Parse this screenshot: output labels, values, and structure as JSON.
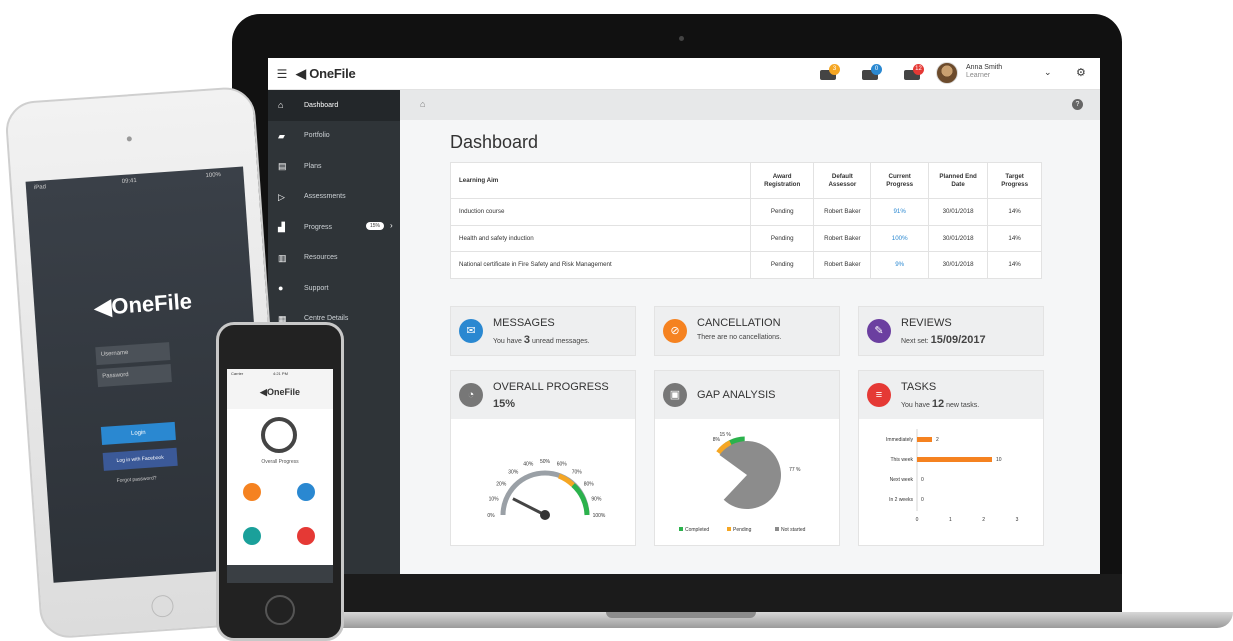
{
  "brand": "OneFile",
  "user": {
    "name": "Anna Smith",
    "role": "Learner"
  },
  "notifications": [
    {
      "icon": "megaphone-icon",
      "count": "3",
      "color": "#f5a623"
    },
    {
      "icon": "message-icon",
      "count": "0",
      "color": "#2a88d1"
    },
    {
      "icon": "tasks-icon",
      "count": "12",
      "color": "#e53935"
    }
  ],
  "sidebar": {
    "items": [
      {
        "label": "Dashboard",
        "icon": "home-icon"
      },
      {
        "label": "Portfolio",
        "icon": "folder-icon"
      },
      {
        "label": "Plans",
        "icon": "plans-icon"
      },
      {
        "label": "Assessments",
        "icon": "assessment-icon"
      },
      {
        "label": "Progress",
        "icon": "chart-icon",
        "badge": "15%"
      },
      {
        "label": "Resources",
        "icon": "resources-icon"
      },
      {
        "label": "Support",
        "icon": "support-icon"
      },
      {
        "label": "Centre Details",
        "icon": "building-icon"
      }
    ]
  },
  "page": {
    "title": "Dashboard"
  },
  "table": {
    "headers": [
      "Learning Aim",
      "Award Registration",
      "Default Assessor",
      "Current Progress",
      "Planned End Date",
      "Target Progress"
    ],
    "rows": [
      [
        "Induction course",
        "Pending",
        "Robert Baker",
        "91%",
        "30/01/2018",
        "14%"
      ],
      [
        "Health and safety induction",
        "Pending",
        "Robert Baker",
        "100%",
        "30/01/2018",
        "14%"
      ],
      [
        "National certificate in Fire Safety and Risk Management",
        "Pending",
        "Robert Baker",
        "9%",
        "30/01/2018",
        "14%"
      ]
    ]
  },
  "cards": {
    "messages": {
      "title": "MESSAGES",
      "pre": "You have",
      "num": "3",
      "post": "unread messages.",
      "color": "#2a88d1"
    },
    "cancellation": {
      "title": "CANCELLATION",
      "sub": "There are no cancellations.",
      "color": "#f58220"
    },
    "reviews": {
      "title": "REVIEWS",
      "pre": "Next set:",
      "date": "15/09/2017",
      "color": "#6b3fa0"
    },
    "progress": {
      "title": "OVERALL PROGRESS",
      "value": "15%",
      "color": "#777"
    },
    "gap": {
      "title": "GAP ANALYSIS",
      "color": "#777"
    },
    "tasks": {
      "title": "TASKS",
      "pre": "You have",
      "num": "12",
      "post": "new tasks.",
      "color": "#e53935"
    }
  },
  "gauge": {
    "value": 15,
    "ticks": [
      "0%",
      "10%",
      "20%",
      "30%",
      "40%",
      "50%",
      "60%",
      "70%",
      "80%",
      "90%",
      "100%"
    ]
  },
  "gap_chart": {
    "slices": [
      {
        "name": "Completed",
        "value": 15,
        "color": "#2bb24c",
        "label": "15 %"
      },
      {
        "name": "Pending",
        "value": 8,
        "color": "#f5a623",
        "label": "8%"
      },
      {
        "name": "Not started",
        "value": 77,
        "color": "#8c8c8c",
        "label": "77 %"
      }
    ]
  },
  "tasks_chart": {
    "categories": [
      "Immediately",
      "This week",
      "Next week",
      "In 2 weeks"
    ],
    "values": [
      2,
      10,
      0,
      0
    ],
    "xticks": [
      "0",
      "1",
      "2",
      "3"
    ],
    "max": 3
  },
  "tablet": {
    "brand": "OneFile",
    "status_left": "iPad",
    "status_time": "09:41",
    "status_battery": "100%",
    "username": "Username",
    "password": "Password",
    "login": "Login",
    "fb": "Log in with Facebook",
    "forgot": "Forgot password?"
  },
  "phone": {
    "brand": "OneFile",
    "carrier": "Carrier",
    "time": "4:21 PM",
    "subtitle": "Overall Progress"
  }
}
